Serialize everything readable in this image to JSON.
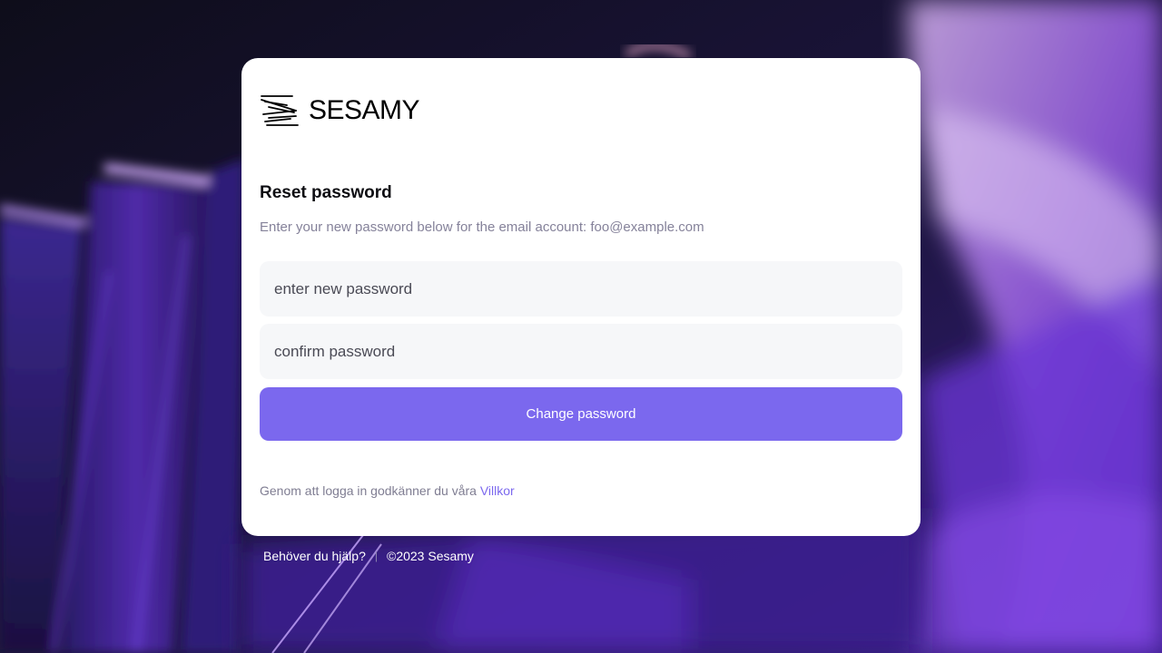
{
  "brand": {
    "name": "SESAMY",
    "accent_color": "#7B68EE"
  },
  "reset_form": {
    "title": "Reset password",
    "subtitle": "Enter your new password below for the email account: foo@example.com",
    "new_password_placeholder": "enter new password",
    "confirm_password_placeholder": "confirm password",
    "submit_label": "Change password"
  },
  "terms": {
    "text": "Genom att logga in godkänner du våra ",
    "link_label": "Villkor"
  },
  "footer": {
    "help_link": "Behöver du hjälp?",
    "separator": "|",
    "copyright": "©2023 Sesamy"
  }
}
